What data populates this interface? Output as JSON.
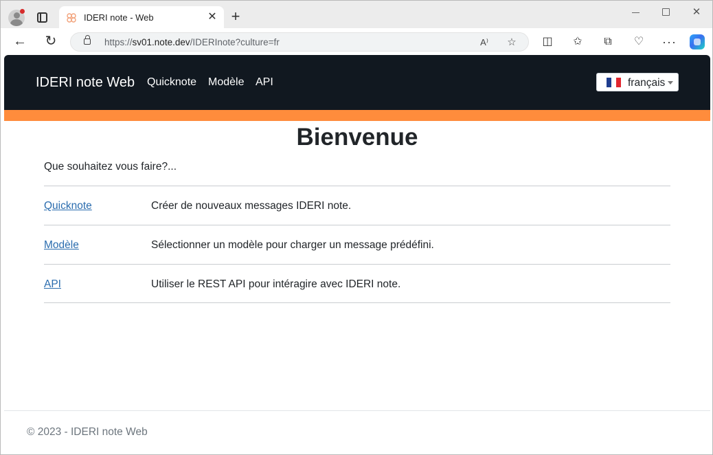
{
  "browser": {
    "tab_title": "IDERI note - Web",
    "url_scheme": "https://",
    "url_domain": "sv01.note.dev",
    "url_path": "/IDERInote?culture=fr",
    "read_aloud_label": "A⁾",
    "icons": [
      "profile-avatar-icon",
      "tab-actions-icon",
      "favicon-icon",
      "close-icon",
      "plus-icon",
      "minimize-icon",
      "maximize-icon",
      "close-window-icon",
      "back-arrow-icon",
      "reload-icon",
      "lock-icon",
      "read-aloud-icon",
      "star-icon",
      "split-screen-icon",
      "favorites-icon",
      "collections-icon",
      "browser-essentials-icon",
      "more-icon",
      "copilot-icon"
    ]
  },
  "navbar": {
    "brand": "IDERI note Web",
    "links": [
      "Quicknote",
      "Modèle",
      "API"
    ],
    "language": "français",
    "background": "#111820",
    "accent": "#ff8c3c"
  },
  "main": {
    "title": "Bienvenue",
    "intro": "Que souhaitez vous faire?...",
    "actions": [
      {
        "link": "Quicknote",
        "description": "Créer de nouveaux messages IDERI note."
      },
      {
        "link": "Modèle",
        "description": "Sélectionner un modèle pour charger un message prédéfini."
      },
      {
        "link": "API",
        "description": "Utiliser le REST API pour intéragire avec IDERI note."
      }
    ],
    "link_color": "#2a6cae"
  },
  "footer": {
    "text": "© 2023 - IDERI note Web"
  }
}
